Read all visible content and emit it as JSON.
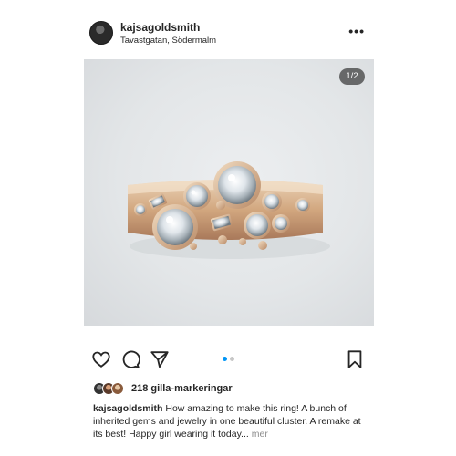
{
  "header": {
    "username": "kajsagoldsmith",
    "location": "Tavastgatan, Södermalm",
    "more_icon": "more-horizontal-icon",
    "more_glyph": "•••"
  },
  "photo": {
    "counter": "1/2",
    "carousel_position": 1,
    "carousel_count": 2
  },
  "actions": {
    "icons": [
      "heart-icon",
      "comment-icon",
      "share-icon",
      "bookmark-icon"
    ]
  },
  "likes": {
    "text": "218 gilla-markeringar"
  },
  "caption": {
    "username": "kajsagoldsmith",
    "text": "How amazing to make this ring! A bunch of inherited gems and jewelry in one beautiful cluster. A remake at its best! Happy girl wearing it today...",
    "more": "mer"
  },
  "colors": {
    "text": "#262626",
    "muted": "#8e8e8e",
    "accent_dot": "#0095f6",
    "inactive_dot": "#c7c7c7"
  }
}
